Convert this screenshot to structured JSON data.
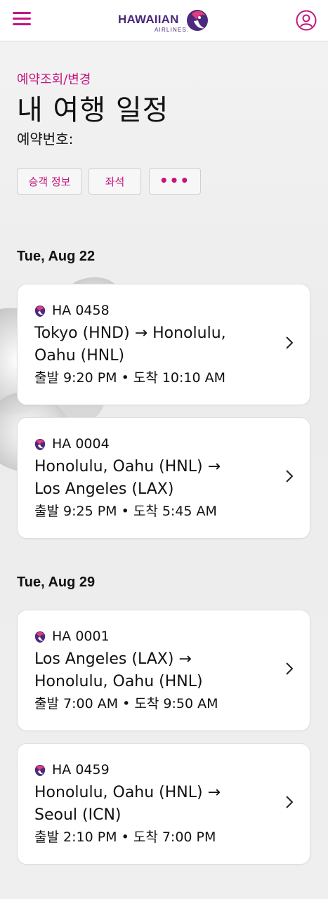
{
  "header": {
    "logo_text": "HAWAIIAN",
    "logo_sub": "AIRLINES."
  },
  "title_block": {
    "breadcrumb": "예약조회/변경",
    "title": "내 여행 일정",
    "confirmation_label": "예약번호:"
  },
  "actions": {
    "passenger_info": "승객 정보",
    "seats": "좌석",
    "more": "•••"
  },
  "days": [
    {
      "date": "Tue, Aug 22",
      "flights": [
        {
          "number": "HA 0458",
          "route_line1": "Tokyo (HND) → Honolulu,",
          "route_line2": "Oahu (HNL)",
          "times": "출발 9:20 PM  •  도착 10:10 AM"
        },
        {
          "number": "HA 0004",
          "route_line1": "Honolulu, Oahu (HNL) →",
          "route_line2": "Los Angeles (LAX)",
          "times": "출발 9:25 PM  •  도착 5:45 AM"
        }
      ]
    },
    {
      "date": "Tue, Aug 29",
      "flights": [
        {
          "number": "HA 0001",
          "route_line1": "Los Angeles (LAX) →",
          "route_line2": "Honolulu, Oahu (HNL)",
          "times": "출발 7:00 AM  •  도착 9:50 AM"
        },
        {
          "number": "HA 0459",
          "route_line1": "Honolulu, Oahu (HNL) →",
          "route_line2": "Seoul (ICN)",
          "times": "출발 2:10 PM  •  도착 7:00 PM"
        }
      ]
    }
  ],
  "colors": {
    "accent": "#c4167f",
    "brand_purple": "#4c2a7d"
  },
  "icons": {
    "menu": "hamburger-menu-icon",
    "profile": "user-profile-icon",
    "airline": "hawaiian-airlines-logo-icon",
    "chevron": "chevron-right-icon"
  }
}
